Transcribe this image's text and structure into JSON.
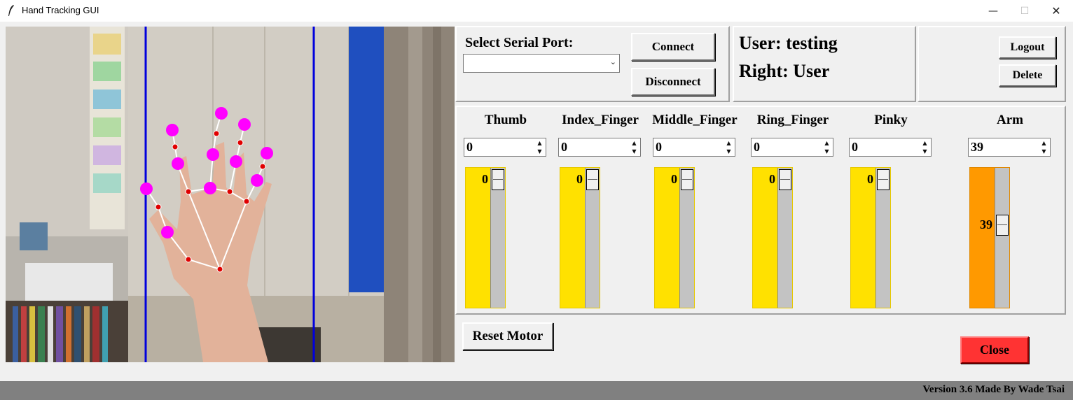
{
  "window": {
    "title": "Hand Tracking GUI",
    "controls": [
      "minimize-icon",
      "maximize-icon",
      "close-icon"
    ]
  },
  "serial": {
    "label": "Select Serial Port:",
    "selected_port": "",
    "connect_label": "Connect",
    "disconnect_label": "Disconnect"
  },
  "user": {
    "user_line": "User: testing",
    "right_line": "Right: User"
  },
  "account": {
    "logout_label": "Logout",
    "delete_label": "Delete"
  },
  "motors": [
    {
      "label": "Thumb",
      "spin_value": "0",
      "scale_value": "0",
      "level": 0,
      "color": "#ffe100"
    },
    {
      "label": "Index_Finger",
      "spin_value": "0",
      "scale_value": "0",
      "level": 0,
      "color": "#ffe100"
    },
    {
      "label": "Middle_Finger",
      "spin_value": "0",
      "scale_value": "0",
      "level": 0,
      "color": "#ffe100"
    },
    {
      "label": "Ring_Finger",
      "spin_value": "0",
      "scale_value": "0",
      "level": 0,
      "color": "#ffe100"
    },
    {
      "label": "Pinky",
      "spin_value": "0",
      "scale_value": "0",
      "level": 0,
      "color": "#ffe100"
    },
    {
      "label": "Arm",
      "spin_value": "39",
      "scale_value": "39",
      "level": 0.39,
      "color": "#ff9900"
    }
  ],
  "controls": {
    "reset_label": "Reset Motor",
    "close_label": "Close",
    "close_color": "#ff3333"
  },
  "status": {
    "version_text": "Version 3.6  Made By Wade Tsai"
  },
  "camera": {
    "guide_line_color": "#0000dd",
    "landmark_color": "#ff00ff",
    "joint_color": "#e00000"
  }
}
